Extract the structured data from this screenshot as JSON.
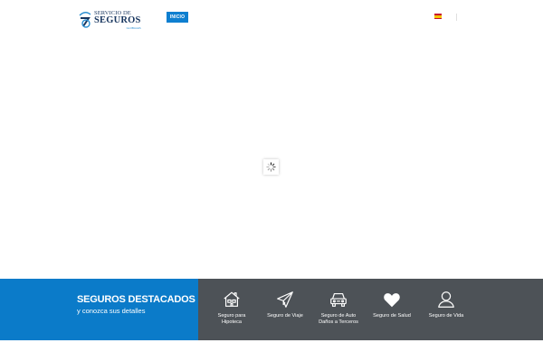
{
  "header": {
    "logo": {
      "top": "SERVICIO DE",
      "main": "SEGUROS",
      "sub": "GLOBALES"
    },
    "nav": {
      "inicio": "INICIO"
    },
    "language_flag": "spain-flag-icon"
  },
  "loader": {
    "icon": "spinner-icon"
  },
  "featured": {
    "title": "SEGUROS DESTACADOS",
    "subtitle": "y conozca sus detalles",
    "colors": {
      "left": "#0b7bc9",
      "right": "#4d5257"
    },
    "items": [
      {
        "line1": "Seguro para",
        "line2": "Hipoteca",
        "icon": "house-icon"
      },
      {
        "line1": "Seguro de Viaje",
        "line2": "",
        "icon": "paper-plane-icon"
      },
      {
        "line1": "Seguro de Auto",
        "line2": "Daños a Terceros",
        "icon": "car-icon"
      },
      {
        "line1": "Seguro de Salud",
        "line2": "",
        "icon": "heart-icon"
      },
      {
        "line1": "Seguro de Vida",
        "line2": "",
        "icon": "person-icon"
      }
    ]
  }
}
